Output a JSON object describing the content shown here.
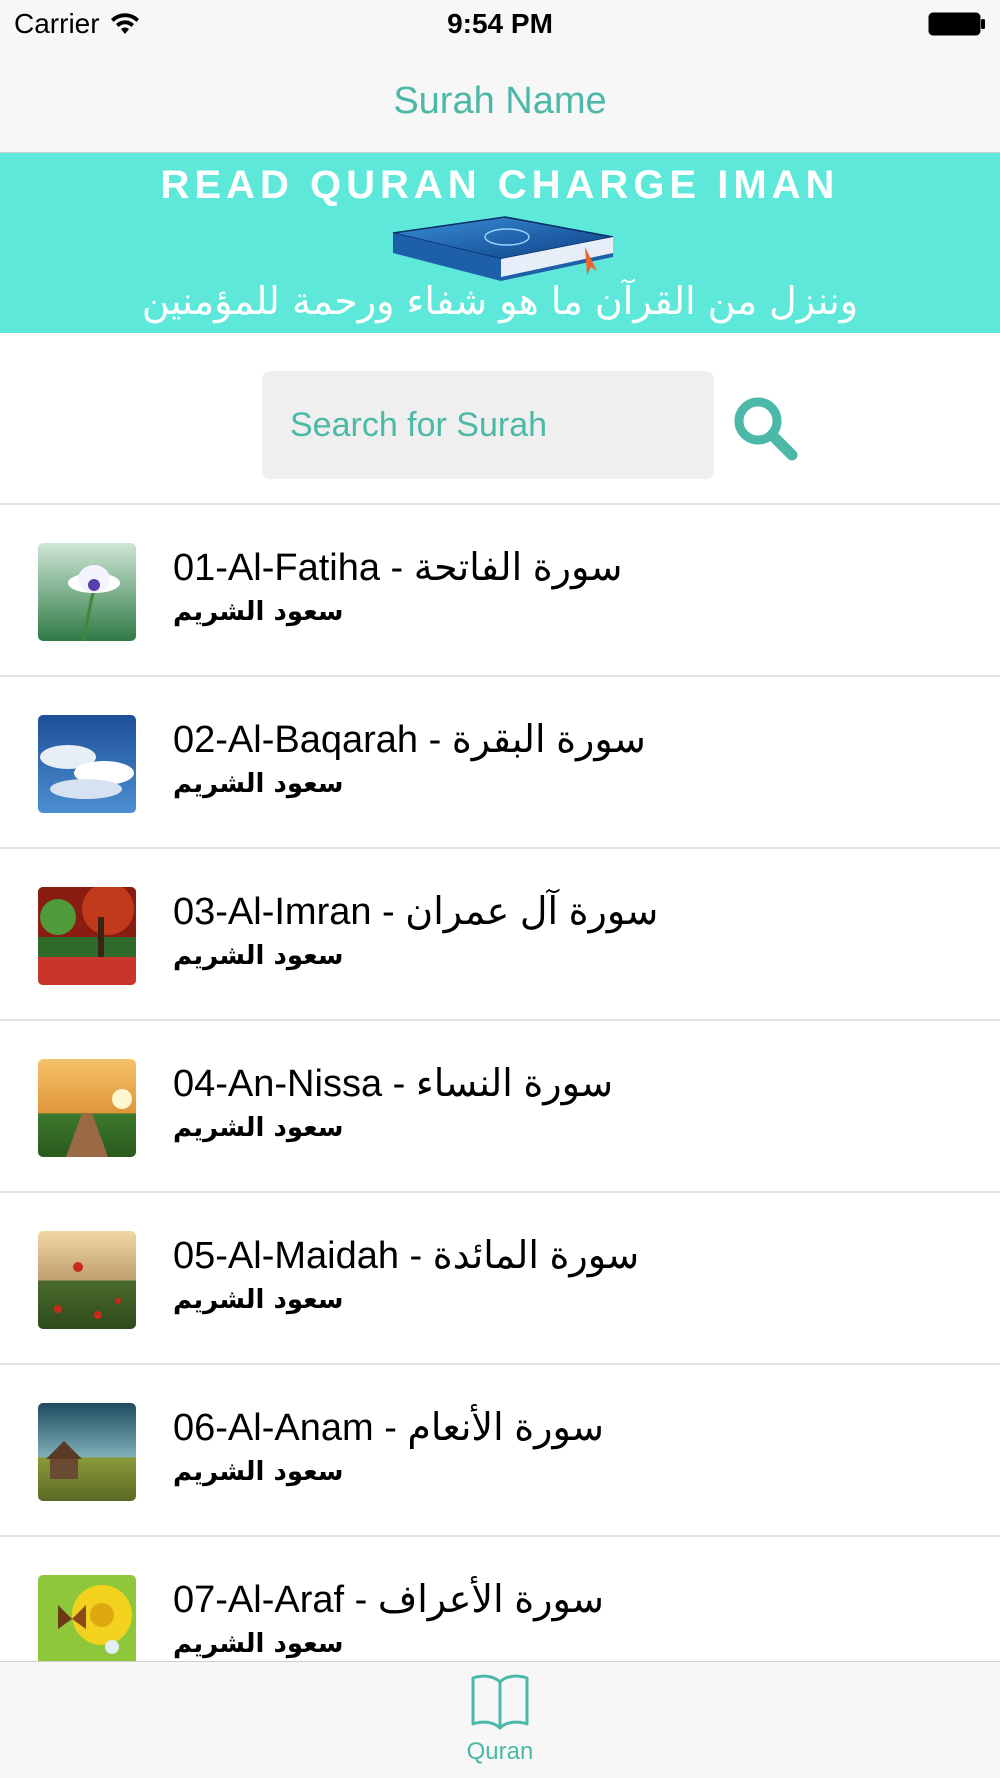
{
  "status_bar": {
    "carrier": "Carrier",
    "time": "9:54 PM"
  },
  "nav": {
    "title": "Surah Name"
  },
  "banner": {
    "heading": "READ QURAN CHARGE IMAN",
    "verse": "وننزل من القرآن ما هو شفاء ورحمة للمؤمنين"
  },
  "search": {
    "placeholder": "Search for Surah",
    "value": ""
  },
  "surahs": [
    {
      "title": "01-Al-Fatiha - سورة الفاتحة",
      "reciter": "سعود الشريم",
      "thumb": "flower"
    },
    {
      "title": "02-Al-Baqarah - سورة البقرة",
      "reciter": "سعود الشريم",
      "thumb": "sky"
    },
    {
      "title": "03-Al-Imran - سورة آل عمران",
      "reciter": "سعود الشريم",
      "thumb": "autumn"
    },
    {
      "title": "04-An-Nissa -  سورة النساء",
      "reciter": "سعود الشريم",
      "thumb": "boardwalk"
    },
    {
      "title": "05-Al-Maidah - سورة المائدة",
      "reciter": "سعود الشريم",
      "thumb": "poppies"
    },
    {
      "title": "06-Al-Anam - سورة الأنعام",
      "reciter": "سعود الشريم",
      "thumb": "cabin"
    },
    {
      "title": "07-Al-Araf - سورة الأعراف",
      "reciter": "سعود الشريم",
      "thumb": "butterfly"
    }
  ],
  "tab_bar": {
    "tabs": [
      {
        "label": "Quran",
        "icon": "book-icon",
        "selected": true
      }
    ]
  },
  "colors": {
    "accent": "#4cb8a8",
    "banner_bg": "#5ee8d9",
    "bar_bg": "#f7f7f7",
    "separator": "#e3e3e3"
  }
}
